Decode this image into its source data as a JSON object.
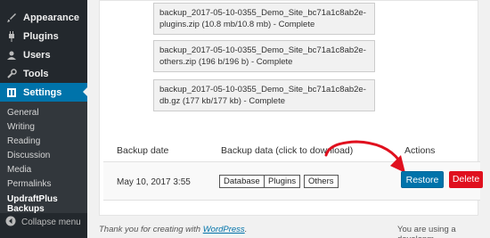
{
  "sidebar": {
    "items": [
      {
        "label": "Appearance",
        "icon": "paintbrush-icon"
      },
      {
        "label": "Plugins",
        "icon": "plug-icon"
      },
      {
        "label": "Users",
        "icon": "user-icon"
      },
      {
        "label": "Tools",
        "icon": "wrench-icon"
      },
      {
        "label": "Settings",
        "icon": "settings-icon"
      }
    ],
    "submenu": [
      "General",
      "Writing",
      "Reading",
      "Discussion",
      "Media",
      "Permalinks",
      "UpdraftPlus Backups"
    ],
    "collapse_label": "Collapse menu"
  },
  "files": [
    {
      "text": "backup_2017-05-10-0355_Demo_Site_bc71a1c8ab2e-plugins.zip (10.8 mb/10.8 mb) - Complete"
    },
    {
      "text": "backup_2017-05-10-0355_Demo_Site_bc71a1c8ab2e-others.zip (196 b/196 b) - Complete"
    },
    {
      "text": "backup_2017-05-10-0355_Demo_Site_bc71a1c8ab2e-db.gz (177 kb/177 kb) - Complete"
    }
  ],
  "table": {
    "headers": [
      "Backup date",
      "Backup data (click to download)",
      "Actions"
    ],
    "row": {
      "date": "May 10, 2017 3:55",
      "data_buttons": [
        "Database",
        "Plugins",
        "Others"
      ],
      "restore_label": "Restore",
      "delete_label": "Delete"
    }
  },
  "footer": {
    "thank_you_prefix": "Thank you for creating with ",
    "wordpress_link": "WordPress",
    "thank_you_suffix": ".",
    "right_text": "You are using a developm"
  }
}
